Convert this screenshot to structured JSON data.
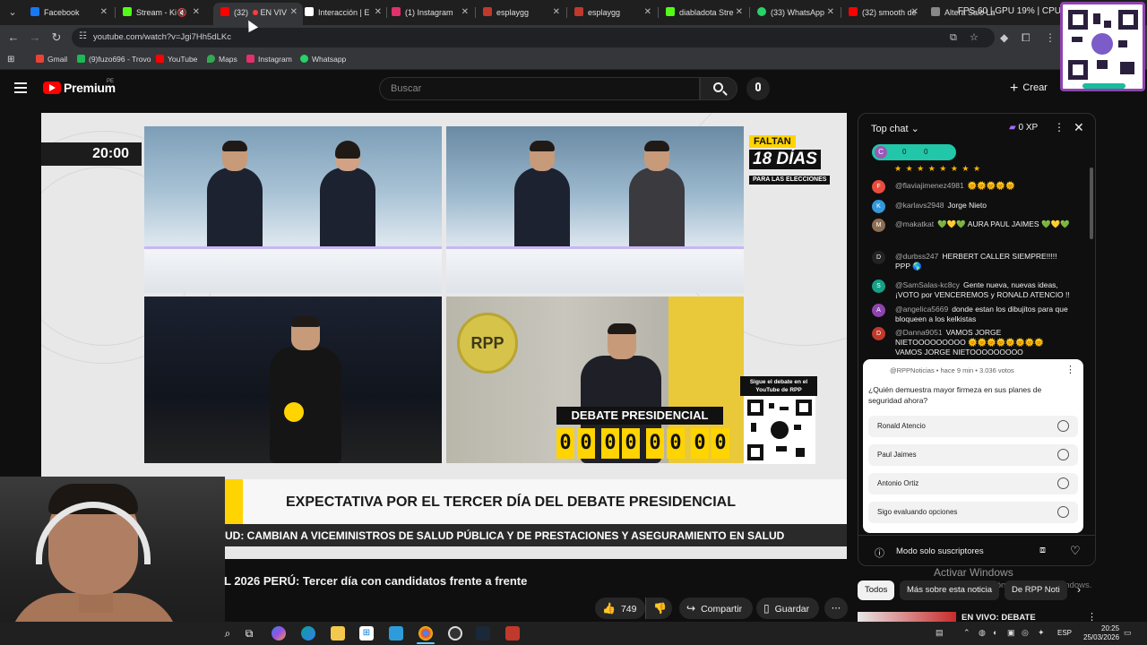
{
  "browser": {
    "tabs": [
      {
        "label": "Facebook",
        "icon": "facebook-icon",
        "color": "#1877f2"
      },
      {
        "label": "Stream - Ki",
        "icon": "kick-icon",
        "color": "#53fc18"
      },
      {
        "label": "(32) ",
        "suffix": "EN VIV",
        "icon": "youtube-icon",
        "color": "#ff0000"
      },
      {
        "label": "Interacción | E",
        "icon": "page-icon",
        "color": "#ffffff"
      },
      {
        "label": "(1) Instagram",
        "icon": "instagram-icon",
        "color": "#e1306c"
      },
      {
        "label": "esplaygg",
        "icon": "esplay-icon",
        "color": "#c0392b"
      },
      {
        "label": "esplaygg",
        "icon": "esplay-icon",
        "color": "#c0392b"
      },
      {
        "label": "diabladota Stre",
        "icon": "kick-icon",
        "color": "#53fc18"
      },
      {
        "label": "(33) WhatsApp",
        "icon": "whatsapp-icon",
        "color": "#25d366"
      },
      {
        "label": "(32) smooth de",
        "icon": "youtube-icon",
        "color": "#ff0000"
      },
      {
        "label": "Altera Salo La",
        "icon": "page-icon",
        "color": "#888888"
      }
    ],
    "system_monitor": "FPS 60 | GPU 19% | CPU",
    "url": "youtube.com/watch?v=Jgi7Hh5dLKc",
    "bookmarks": [
      {
        "label": "Gmail",
        "color": "#ea4335"
      },
      {
        "label": "(9)fuzo696 - Trovo",
        "color": "#1db954"
      },
      {
        "label": "YouTube",
        "color": "#ff0000"
      },
      {
        "label": "Maps",
        "color": "#34a853"
      },
      {
        "label": "Instagram",
        "color": "#e1306c"
      },
      {
        "label": "Whatsapp",
        "color": "#25d366"
      }
    ]
  },
  "youtube": {
    "brand": "Premium",
    "country": "PE",
    "search_placeholder": "Buscar",
    "create_label": "Crear"
  },
  "video": {
    "clock": "20:00",
    "faltan_label": "FALTAN",
    "faltan_days": "18 DÍAS",
    "faltan_sub": "PARA LAS ELECCIONES",
    "rpp_logo": "RPP",
    "qr_label": "Sigue el debate en el YouTube de RPP",
    "debate_banner": "DEBATE PRESIDENCIAL",
    "countdown": [
      "0",
      "0",
      "0",
      "0",
      "0",
      "0",
      "0",
      "0"
    ],
    "headline": "EXPECTATIVA POR EL TERCER DÍA DEL DEBATE PRESIDENCIAL",
    "subheadline": "UD: CAMBIAN A VICEMINISTROS DE SALUD PÚBLICA Y DE PRESTACIONES Y ASEGURAMIENTO EN SALUD",
    "title": "L 2026 PERÚ: Tercer día con candidatos frente a frente"
  },
  "actions": {
    "likes": "749",
    "share": "Compartir",
    "save": "Guardar"
  },
  "chat": {
    "mode": "Top chat",
    "xp": "0 XP",
    "goal_value": "0",
    "goal_value2": "0",
    "goal_initial": "C",
    "messages": [
      {
        "initial": "F",
        "color": "#e74c3c",
        "user": "@flaviajimenez4981",
        "text": "🌞🌞🌞🌞🌞"
      },
      {
        "initial": "K",
        "color": "#3498db",
        "user": "@karlavs2948",
        "text": "Jorge Nieto"
      },
      {
        "initial": "M",
        "color": "#8e6e53",
        "user": "@makatkat",
        "text": "💚💛💚 AURA PAUL JAIMES 💚💛💚"
      },
      {
        "initial": "D",
        "color": "#222222",
        "user": "@durbss247",
        "text": "HERBERT CALLER SIEMPRE!!!!! PPP 🌎"
      },
      {
        "initial": "S",
        "color": "#16a085",
        "user": "@SamSalas-kc8cy",
        "text": "Gente nueva, nuevas ideas, ¡VOTO por VENCEREMOS y RONALD ATENCIO !!"
      },
      {
        "initial": "A",
        "color": "#8e44ad",
        "user": "@angelica5669",
        "text": "donde estan los dibujitos para que bloqueen a los kelkistas"
      },
      {
        "initial": "D",
        "color": "#c0392b",
        "user": "@Danna9051",
        "text": "VAMOS JORGE NIETOOOOOOOOO 🌞🌞🌞🌞🌞🌞🌞🌞 VAMOS JORGE NIETOOOOOOOOO"
      }
    ],
    "poll": {
      "meta": "@RPPNoticias • hace 9 min • 3.036 votos",
      "question": "¿Quién demuestra mayor firmeza en sus planes de seguridad ahora?",
      "options": [
        "Ronald Atencio",
        "Paul Jaimes",
        "Antonio Ortiz",
        "Sigo evaluando opciones"
      ]
    },
    "footer": "Modo solo suscriptores"
  },
  "windows": {
    "activate_title": "Activar Windows",
    "activate_sub": "Ve a Configuración para activar Windows."
  },
  "related": {
    "chips": [
      "Todos",
      "Más sobre esta noticia",
      "De RPP Noti"
    ],
    "first_title": "EN VIVO: DEBATE"
  },
  "taskbar": {
    "lang": "ESP",
    "time": "20:25",
    "date": "25/03/2026"
  }
}
